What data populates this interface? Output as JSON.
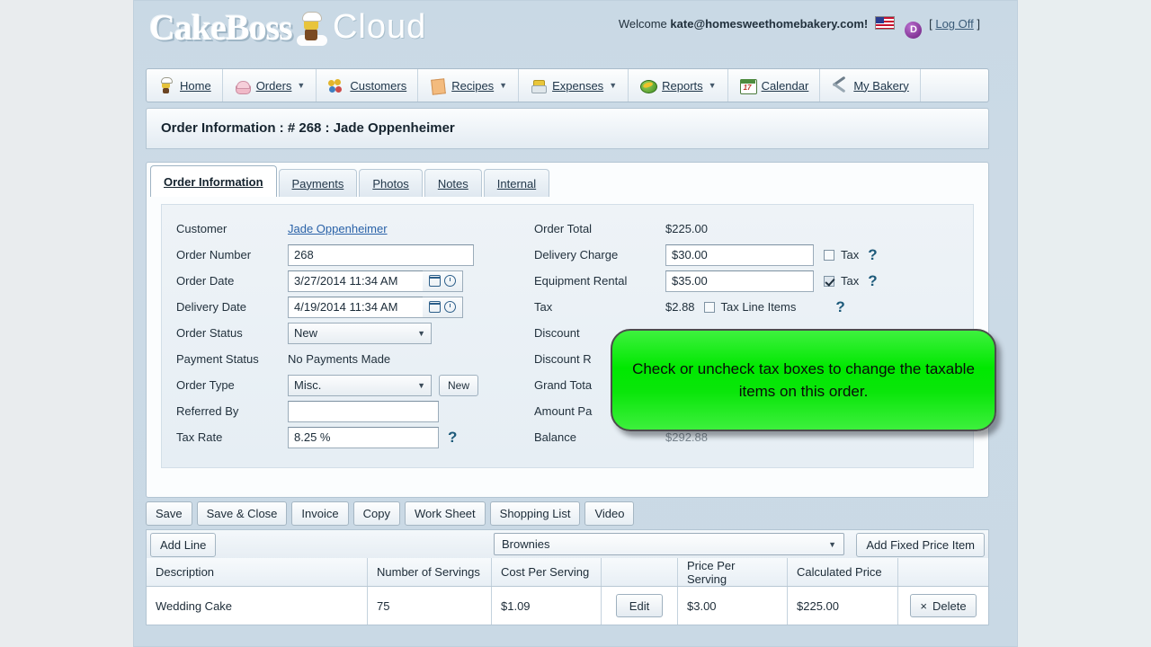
{
  "header": {
    "logo_cake": "CakeBoss",
    "logo_cloud": "Cloud",
    "welcome_prefix": "Welcome",
    "welcome_email": "kate@homesweethomebakery.com!",
    "flag_icon": "us-flag-icon",
    "account_badge": "D",
    "logoff_open": "[",
    "logoff": "Log Off",
    "logoff_close": "]"
  },
  "nav": [
    {
      "label": "Home",
      "icon": "chef-home-icon",
      "caret": ""
    },
    {
      "label": "Orders",
      "icon": "cupcake-icon",
      "caret": "▼"
    },
    {
      "label": "Customers",
      "icon": "people-icon",
      "caret": ""
    },
    {
      "label": "Recipes",
      "icon": "recipe-card-icon",
      "caret": "▼"
    },
    {
      "label": "Expenses",
      "icon": "money-bag-icon",
      "caret": "▼"
    },
    {
      "label": "Reports",
      "icon": "report-globe-icon",
      "caret": "▼"
    },
    {
      "label": "Calendar",
      "icon": "calendar-icon",
      "caret": ""
    },
    {
      "label": "My Bakery",
      "icon": "tools-icon",
      "caret": ""
    }
  ],
  "page_title": "Order Information : # 268 : Jade Oppenheimer",
  "tabs": [
    {
      "label": "Order Information",
      "active": true
    },
    {
      "label": "Payments",
      "active": false
    },
    {
      "label": "Photos",
      "active": false
    },
    {
      "label": "Notes",
      "active": false
    },
    {
      "label": "Internal",
      "active": false
    }
  ],
  "form_left": {
    "customer_label": "Customer",
    "customer_value": "Jade Oppenheimer",
    "order_number_label": "Order Number",
    "order_number_value": "268",
    "order_date_label": "Order Date",
    "order_date_value": "3/27/2014 11:34 AM",
    "delivery_date_label": "Delivery Date",
    "delivery_date_value": "4/19/2014 11:34 AM",
    "order_status_label": "Order Status",
    "order_status_value": "New",
    "payment_status_label": "Payment Status",
    "payment_status_value": "No Payments Made",
    "order_type_label": "Order Type",
    "order_type_value": "Misc.",
    "order_type_new_button": "New",
    "referred_by_label": "Referred By",
    "referred_by_value": "",
    "tax_rate_label": "Tax Rate",
    "tax_rate_value": "8.25 %",
    "help_glyph": "?"
  },
  "form_right": {
    "order_total_label": "Order Total",
    "order_total_value": "$225.00",
    "delivery_charge_label": "Delivery Charge",
    "delivery_charge_value": "$30.00",
    "delivery_charge_tax_label": "Tax",
    "delivery_charge_tax_checked": false,
    "equipment_rental_label": "Equipment Rental",
    "equipment_rental_value": "$35.00",
    "equipment_rental_tax_label": "Tax",
    "equipment_rental_tax_checked": true,
    "tax_label": "Tax",
    "tax_value": "$2.88",
    "tax_line_items_label": "Tax Line Items",
    "tax_line_items_checked": false,
    "discount_label": "Discount",
    "discount_reason_label": "Discount R",
    "grand_total_label": "Grand Tota",
    "amount_paid_label": "Amount Pa",
    "balance_label": "Balance",
    "balance_value": "$292.88",
    "help_glyph": "?"
  },
  "callout": {
    "text": "Check or uncheck tax boxes to change the taxable items on this order.",
    "color": "#00e800"
  },
  "action_buttons": [
    "Save",
    "Save & Close",
    "Invoice",
    "Copy",
    "Work Sheet",
    "Shopping List",
    "Video"
  ],
  "line_bar": {
    "add_line_button": "Add Line",
    "recipe_select_value": "Brownies",
    "recipe_select_caret": "▼",
    "add_fixed_price_button": "Add Fixed Price Item"
  },
  "items_table": {
    "columns": [
      "Description",
      "Number of Servings",
      "Cost Per Serving",
      "",
      "Price Per Serving",
      "Calculated Price",
      ""
    ],
    "rows": [
      {
        "description": "Wedding Cake",
        "servings": "75",
        "cost_per_serving": "$1.09",
        "edit_button": "Edit",
        "price_per_serving": "$3.00",
        "calculated_price": "$225.00",
        "delete_button": "Delete",
        "delete_glyph": "×"
      }
    ]
  }
}
